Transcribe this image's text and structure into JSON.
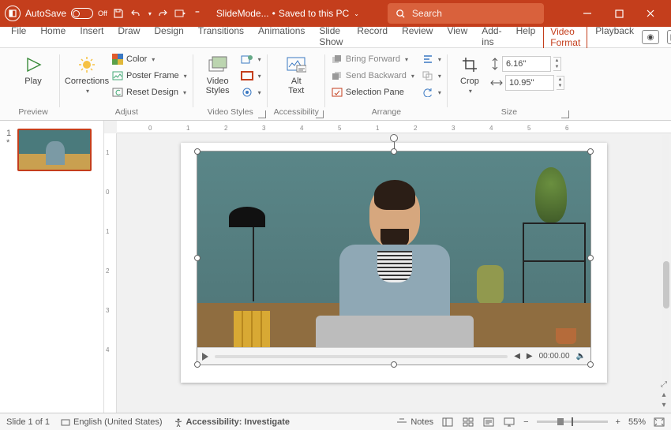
{
  "titlebar": {
    "autosave_label": "AutoSave",
    "autosave_state": "Off",
    "doc_name": "SlideMode...",
    "save_status": "Saved to this PC",
    "search_placeholder": "Search"
  },
  "tabs": {
    "items": [
      "File",
      "Home",
      "Insert",
      "Draw",
      "Design",
      "Transitions",
      "Animations",
      "Slide Show",
      "Record",
      "Review",
      "View",
      "Add-ins",
      "Help",
      "Video Format",
      "Playback"
    ],
    "active": "Video Format"
  },
  "ribbon": {
    "preview": {
      "play": "Play",
      "label": "Preview"
    },
    "adjust": {
      "corrections": "Corrections",
      "color": "Color",
      "poster_frame": "Poster Frame",
      "reset_design": "Reset Design",
      "label": "Adjust"
    },
    "video_styles": {
      "btn": "Video\nStyles",
      "label": "Video Styles"
    },
    "accessibility": {
      "alt_text": "Alt\nText",
      "label": "Accessibility"
    },
    "arrange": {
      "bring_forward": "Bring Forward",
      "send_backward": "Send Backward",
      "selection_pane": "Selection Pane",
      "label": "Arrange"
    },
    "size": {
      "crop": "Crop",
      "height": "6.16\"",
      "width": "10.95\"",
      "label": "Size"
    }
  },
  "ruler_h": [
    "0",
    "1",
    "2",
    "3",
    "4",
    "5",
    "1",
    "2",
    "3",
    "4",
    "5",
    "6"
  ],
  "ruler_v": [
    "1",
    "0",
    "1",
    "2",
    "3",
    "4"
  ],
  "slidepanel": {
    "slide_number": "1",
    "star": "*"
  },
  "video": {
    "time": "00:00.00"
  },
  "statusbar": {
    "slide": "Slide 1 of 1",
    "lang": "English (United States)",
    "accessibility": "Accessibility: Investigate",
    "notes": "Notes",
    "zoom": "55%"
  }
}
